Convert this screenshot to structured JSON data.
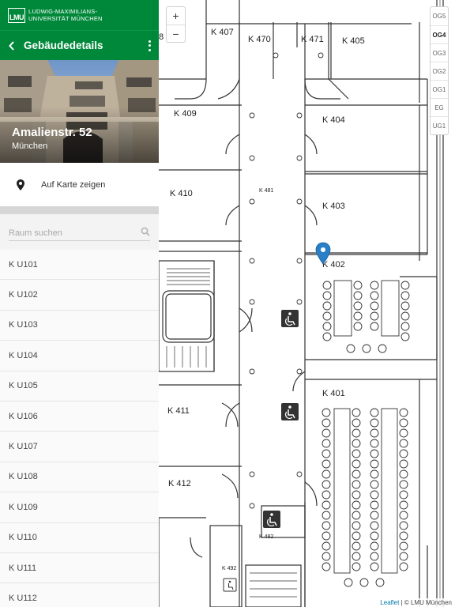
{
  "logo": {
    "mark": "LMU",
    "line1": "LUDWIG-MAXIMILIANS-",
    "line2": "UNIVERSITÄT MÜNCHEN"
  },
  "topbar": {
    "title": "Gebäudedetails"
  },
  "building": {
    "name": "Amalienstr. 52",
    "city": "München"
  },
  "actions": {
    "show_on_map": "Auf Karte zeigen"
  },
  "search": {
    "placeholder": "Raum suchen",
    "value": ""
  },
  "rooms": [
    "K U101",
    "K U102",
    "K U103",
    "K U104",
    "K U105",
    "K U106",
    "K U107",
    "K U108",
    "K U109",
    "K U110",
    "K U111",
    "K U112"
  ],
  "map": {
    "zoom_in": "+",
    "zoom_out": "−",
    "floors": [
      "OG5",
      "OG4",
      "OG3",
      "OG2",
      "OG1",
      "EG",
      "UG1"
    ],
    "active_floor": "OG4",
    "room_labels": {
      "k407": "K 407",
      "k470": "K 470",
      "k471": "K 471",
      "k405": "K 405",
      "k409": "K 409",
      "k404": "K 404",
      "k481": "K 481",
      "k410": "K 410",
      "k403": "K 403",
      "k402": "K 402",
      "k401": "K 401",
      "k411": "K 411",
      "k412": "K 412",
      "k482": "K 482",
      "k492": "K 492",
      "partial": "8"
    },
    "attribution_link": "Leaflet",
    "attribution_text": " | © LMU München"
  },
  "colors": {
    "brand_green": "#00883a",
    "marker_blue": "#2a80c8",
    "sidebar_bg": "#f3f3f3"
  },
  "icons": {
    "back": "chevron-left-icon",
    "menu": "more-vert-icon",
    "pin": "map-pin-icon",
    "search": "search-icon",
    "wheelchair": "wheelchair-icon",
    "marker": "map-marker-icon"
  }
}
